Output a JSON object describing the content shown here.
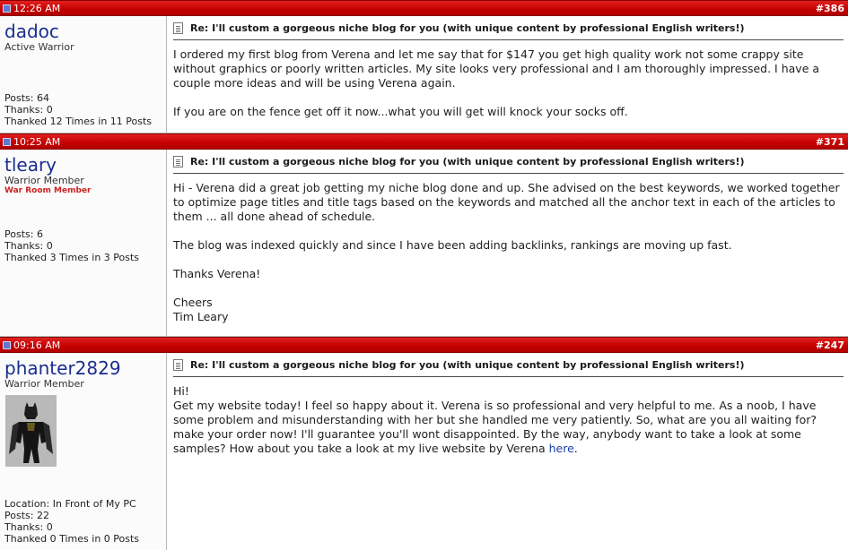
{
  "posts": [
    {
      "time": "12:26 AM",
      "number": "#386",
      "username": "dadoc",
      "user_title": "Active Warrior",
      "stats": [
        "Posts: 64",
        "Thanks: 0",
        "Thanked 12 Times in 11 Posts"
      ],
      "subject": "Re: I'll custom a gorgeous niche blog for you (with unique content by professional English writers!)",
      "paragraphs": [
        "I ordered my first blog from Verena and let me say that for $147 you get high quality work not some crappy site without graphics or poorly written articles. My site looks very professional and I am thoroughly impressed. I have a couple more ideas and will be using Verena again.",
        "If you are on the fence get off it now...what you will get will knock your socks off."
      ]
    },
    {
      "time": "10:25 AM",
      "number": "#371",
      "username": "tleary",
      "user_title": "Warrior Member",
      "badge": "War Room Member",
      "stats": [
        "Posts: 6",
        "Thanks: 0",
        "Thanked 3 Times in 3 Posts"
      ],
      "subject": "Re: I'll custom a gorgeous niche blog for you (with unique content by professional English writers!)",
      "paragraphs": [
        "Hi - Verena did a great job getting my niche blog done and up. She advised on the best keywords, we worked together to optimize page titles and title tags based on the keywords and matched all the anchor text in each of the articles to them ... all done ahead of schedule.",
        "The blog was indexed quickly and since I have been adding backlinks, rankings are moving up fast.",
        "Thanks Verena!",
        "Cheers",
        "Tim Leary"
      ]
    },
    {
      "time": "09:16 AM",
      "number": "#247",
      "username": "phanter2829",
      "user_title": "Warrior Member",
      "stats": [
        "Location: In Front of My PC",
        "Posts: 22",
        "Thanks: 0",
        "Thanked 0 Times in 0 Posts"
      ],
      "subject": "Re: I'll custom a gorgeous niche blog for you (with unique content by professional English writers!)",
      "greeting": "Hi!",
      "body": "Get my website today! I feel so happy about it. Verena is so professional and very helpful to me. As a noob, I have some problem and misunderstanding with her but she handled me very patiently. So, what are you all waiting for? make your order now! I'll guarantee you'll wont disappointed. By the way, anybody want to take a look at some samples? How about you take a look at my live website by Verena",
      "link_text": "here",
      "trailing": "."
    }
  ],
  "colors": {
    "bar": "#c40000",
    "username": "#1a2e8f",
    "badge": "#cc2222",
    "link": "#1a3fa8"
  },
  "icons": [
    "post-icon",
    "document-icon"
  ]
}
